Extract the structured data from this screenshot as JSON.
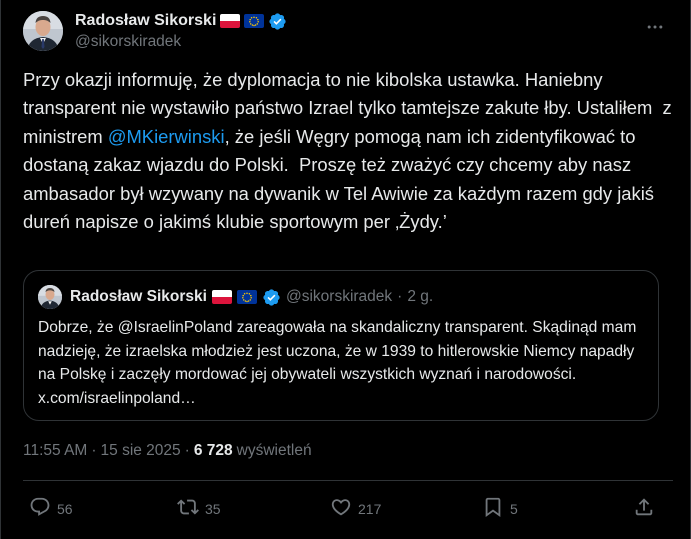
{
  "author": {
    "display_name": "Radosław Sikorski",
    "handle": "@sikorskiradek",
    "badges": [
      "flag-poland-icon",
      "flag-eu-icon",
      "verified-icon"
    ]
  },
  "tweet": {
    "text_before": "Przy okazji informuję, że dyplomacja to nie kibolska ustawka. Haniebny transparent nie wystawiło państwo Izrael tylko tamtejsze zakute łby. Ustaliłem  z ministrem ",
    "mention": "@MKierwinski",
    "text_after": ", że jeśli Węgry pomogą nam ich zidentyfikować to dostaną zakaz wjazdu do Polski.  Proszę też zważyć czy chcemy aby nasz ambasador był wzywany na dywanik w Tel Awiwie za każdym razem gdy jakiś dureń napisze o jakimś klubie sportowym per ‚Żydy.’"
  },
  "quoted": {
    "display_name": "Radosław Sikorski",
    "handle": "@sikorskiradek",
    "separator": "·",
    "age": "2 g.",
    "text": "Dobrze, że @IsraelinPoland zareagowała na skandaliczny transparent. Skądinąd mam nadzieję, że izraelska młodzież jest uczona, że w 1939 to hitlerowskie Niemcy napadły na Polskę i zaczęły mordować jej obywateli wszystkich wyznań i narodowości. x.com/israelinpoland…"
  },
  "meta": {
    "time": "11:55 AM",
    "separator": "·",
    "date": "15 sie 2025",
    "views_count": "6 728",
    "views_label": "wyświetleń"
  },
  "actions": {
    "replies": "56",
    "reposts": "35",
    "likes": "217",
    "bookmarks": "5"
  },
  "colors": {
    "background": "#000000",
    "text": "#e7e9ea",
    "muted": "#71767b",
    "link": "#1d9bf0",
    "border": "#2f3336",
    "verified": "#1d9bf0"
  }
}
